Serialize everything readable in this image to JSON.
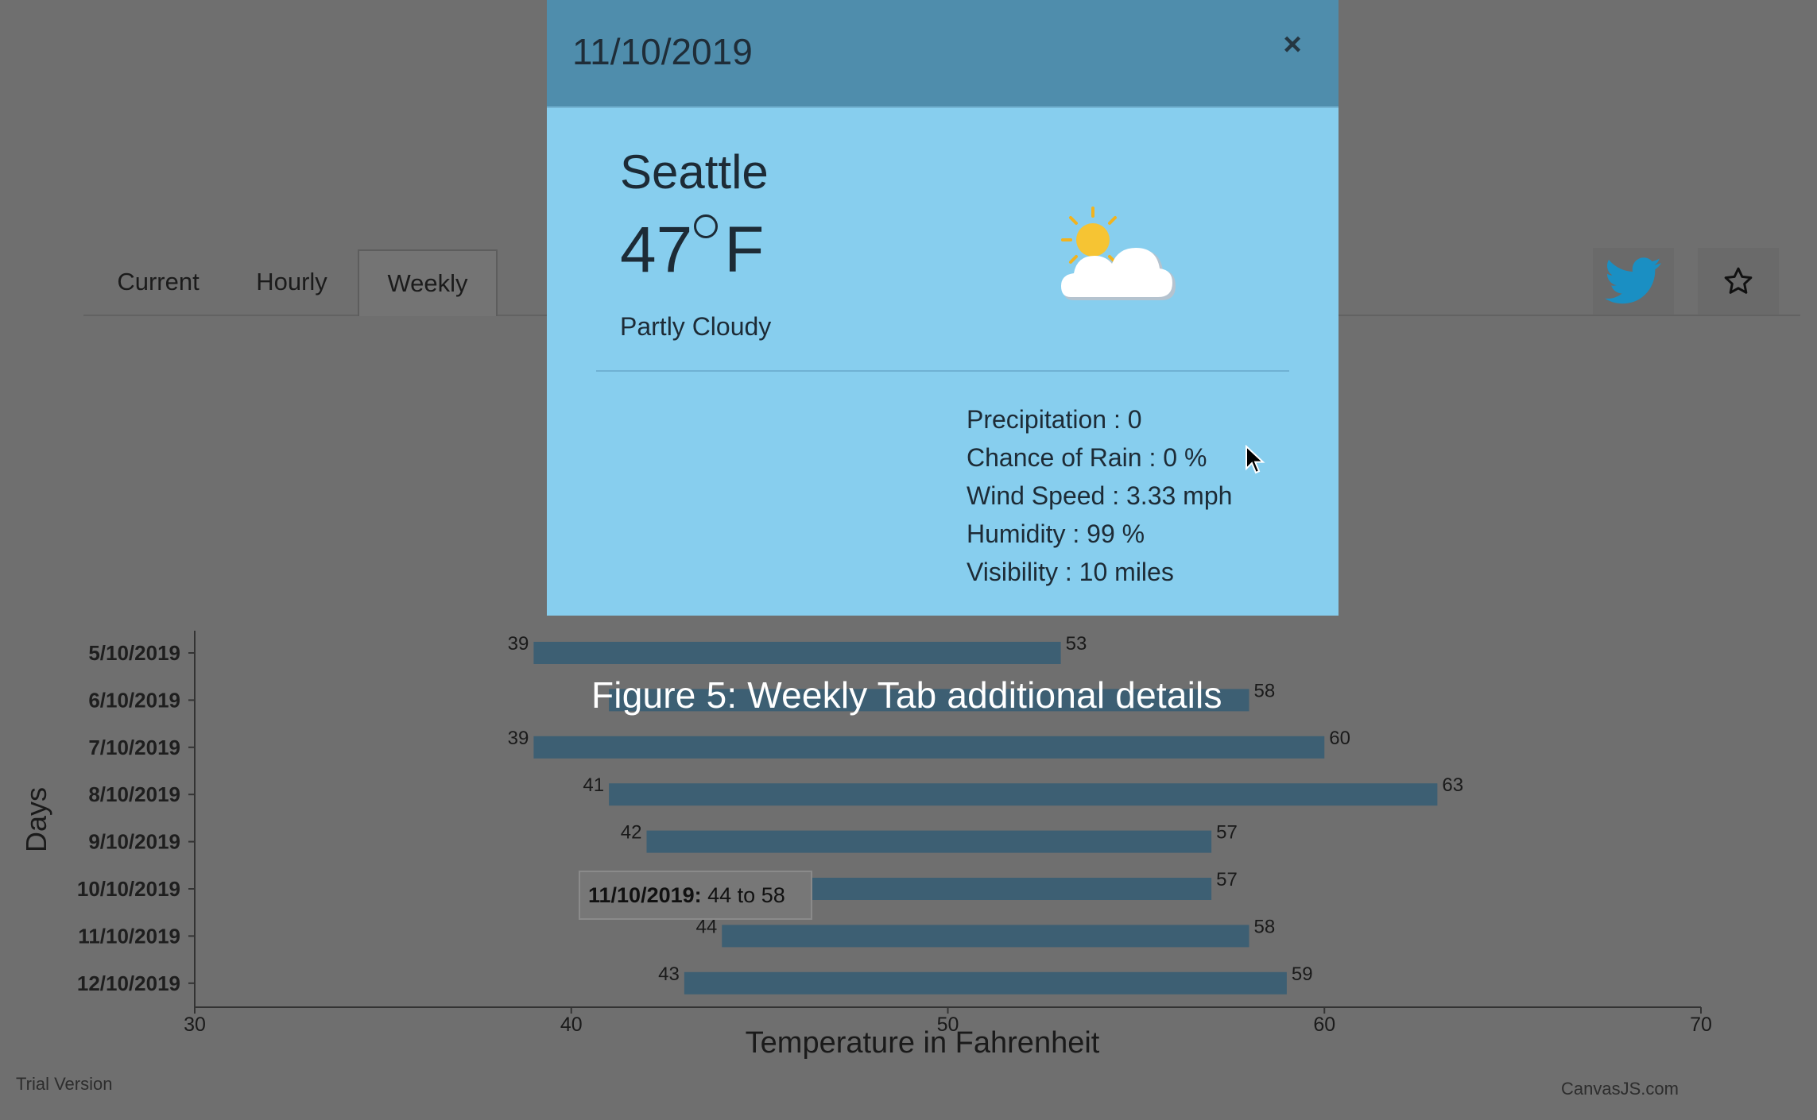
{
  "tabs": [
    {
      "label": "Current",
      "active": false
    },
    {
      "label": "Hourly",
      "active": false
    },
    {
      "label": "Weekly",
      "active": true
    }
  ],
  "modal": {
    "date": "11/10/2019",
    "close_symbol": "×",
    "city": "Seattle",
    "temperature": "47",
    "unit": "F",
    "condition": "Partly Cloudy",
    "weather_icon": "partly-cloudy-icon",
    "details": [
      "Precipitation : 0",
      "Chance of Rain : 0 %",
      "Wind Speed : 3.33 mph",
      "Humidity : 99 %",
      "Visibility : 10 miles"
    ]
  },
  "caption": "Figure 5: Weekly Tab additional details",
  "footer": {
    "trial": "Trial Version",
    "credit": "CanvasJS.com"
  },
  "tooltip": {
    "date": "11/10/2019:",
    "range": " 44 to 58"
  },
  "colors": {
    "bar": "#3d5f73",
    "modal_bg": "#87ceee",
    "modal_header": "#4f8dac",
    "twitter": "#1a9ed6"
  },
  "chart_data": {
    "type": "bar",
    "orientation": "horizontal",
    "xlabel": "Temperature in Fahrenheit",
    "ylabel": "Days",
    "xlim": [
      30,
      70
    ],
    "xticks": [
      30,
      40,
      50,
      60,
      70
    ],
    "categories": [
      "5/10/2019",
      "6/10/2019",
      "7/10/2019",
      "8/10/2019",
      "9/10/2019",
      "10/10/2019",
      "11/10/2019",
      "12/10/2019"
    ],
    "low": [
      39,
      41,
      39,
      41,
      42,
      44,
      44,
      43
    ],
    "high": [
      53,
      58,
      60,
      63,
      57,
      57,
      58,
      59
    ],
    "low_labels_visible": [
      true,
      false,
      true,
      true,
      true,
      false,
      true,
      true
    ]
  }
}
